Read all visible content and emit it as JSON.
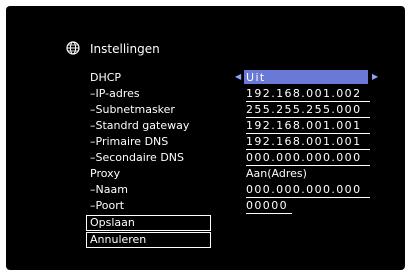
{
  "header": {
    "title": "Instellingen",
    "icon": "globe-icon"
  },
  "rows": [
    {
      "label": "DHCP",
      "value": "Uit"
    },
    {
      "label": "–IP-adres",
      "value": "192.168.001.002"
    },
    {
      "label": "–Subnetmasker",
      "value": "255.255.255.000"
    },
    {
      "label": "–Standrd gateway",
      "value": "192.168.001.001"
    },
    {
      "label": "–Primaire DNS",
      "value": "192.168.001.001"
    },
    {
      "label": "–Secondaire DNS",
      "value": "000.000.000.000"
    },
    {
      "label": "Proxy",
      "value": "Aan(Adres)"
    },
    {
      "label": "–Naam",
      "value": "000.000.000.000"
    },
    {
      "label": "–Poort",
      "value": "00000"
    }
  ],
  "buttons": {
    "save": "Opslaan",
    "cancel": "Annuleren"
  },
  "colors": {
    "background": "#000000",
    "selection": "#6a79d6",
    "text": "#ffffff"
  }
}
